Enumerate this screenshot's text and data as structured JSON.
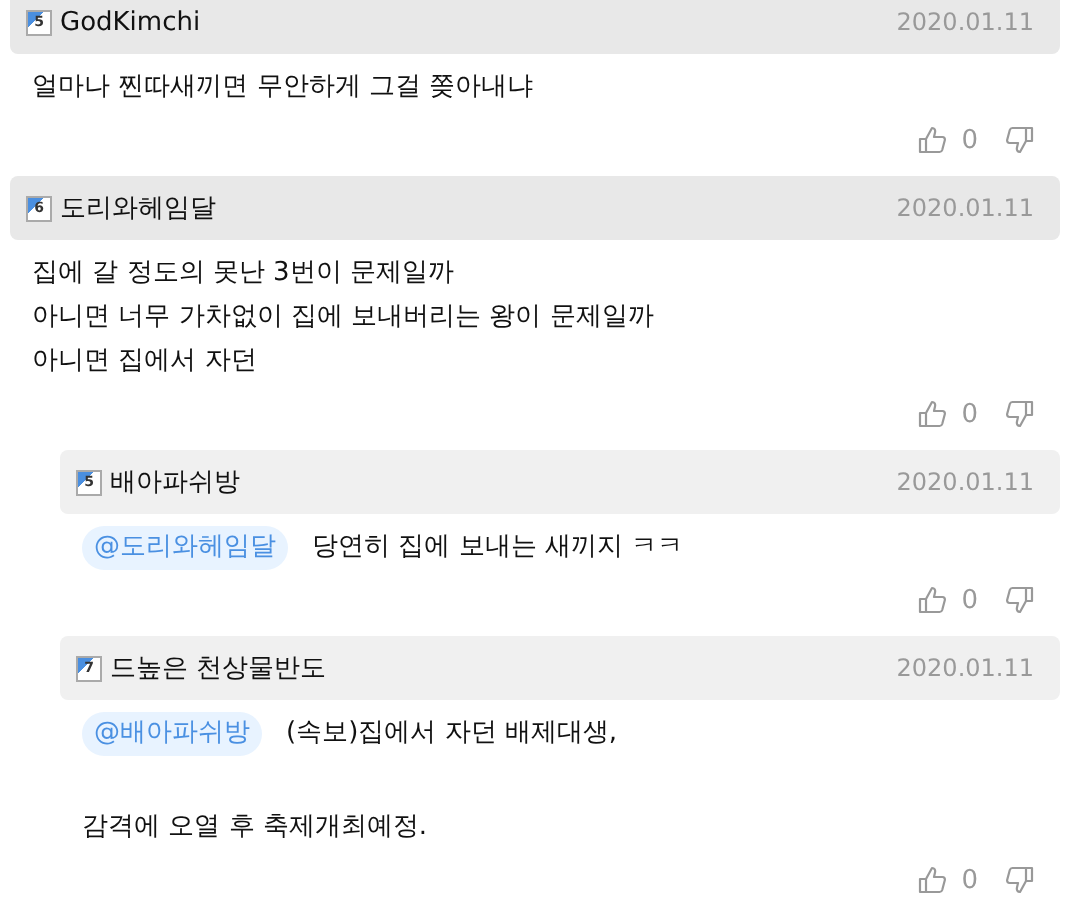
{
  "comments": [
    {
      "kind": "top",
      "level": "5",
      "author": "GodKimchi",
      "date": "2020.01.11",
      "paragraphs": [
        [
          "얼마나 찐따새끼면 무안하게 그걸 쫒아내냐"
        ]
      ],
      "likes": "0"
    },
    {
      "kind": "top",
      "level": "6",
      "author": "도리와헤임달",
      "date": "2020.01.11",
      "paragraphs": [
        [
          "집에 갈 정도의 못난 3번이 문제일까",
          "아니면 너무 가차없이 집에 보내버리는 왕이 문제일까",
          "아니면 집에서 자던"
        ]
      ],
      "likes": "0"
    },
    {
      "kind": "reply",
      "level": "5",
      "author": "배아파쉬방",
      "date": "2020.01.11",
      "mention": "@도리와헤임달",
      "paragraphs": [
        [
          "당연히 집에 보내는 새끼지 ㅋㅋ"
        ]
      ],
      "likes": "0"
    },
    {
      "kind": "reply",
      "level": "7",
      "author": "드높은 천상물반도",
      "date": "2020.01.11",
      "mention": "@배아파쉬방",
      "paragraphs": [
        [
          "(속보)집에서 자던 배제대생,"
        ],
        [
          "감격에 오열 후 축제개최예정."
        ]
      ],
      "likes": "0"
    }
  ]
}
